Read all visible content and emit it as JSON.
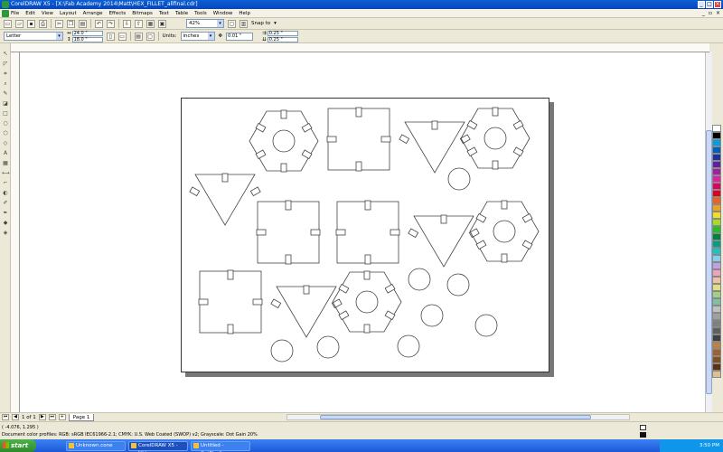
{
  "window": {
    "title": "CorelDRAW X5 - [X:\\Fab Academy 2014\\Matt\\HEX_FILLET_allfinal.cdr]"
  },
  "menubar": {
    "items": [
      "File",
      "Edit",
      "View",
      "Layout",
      "Arrange",
      "Effects",
      "Bitmaps",
      "Text",
      "Table",
      "Tools",
      "Window",
      "Help"
    ]
  },
  "toolbar": {
    "zoom": "42%",
    "snap": "Snap to"
  },
  "propertybar": {
    "paper": "Letter",
    "width": "24.0 \"",
    "height": "18.0 \"",
    "units_label": "Units:",
    "units": "inches",
    "nudge": "0.01 \"",
    "dup_x": "0.25 \"",
    "dup_y": "0.25 \""
  },
  "pagenav": {
    "counter": "1 of 1",
    "tab": "Page 1"
  },
  "status": {
    "coords": "( -4.076, 1.295 )",
    "profile": "Document color profiles: RGB: sRGB IEC61966-2.1; CMYK: U.S. Web Coated (SWOP) v2; Grayscale: Dot Gain 20%"
  },
  "taskbar": {
    "start": "start",
    "tasks": [
      "Unknown.cone",
      "CorelDRAW X5 - [X:\\...",
      "Untitled - CutStudio"
    ],
    "clock": "3:50 PM"
  },
  "palette": [
    "#ffffff",
    "#000000",
    "#00a0e0",
    "#0060c0",
    "#2030a0",
    "#6020a0",
    "#a020a0",
    "#e020a0",
    "#e00060",
    "#e00020",
    "#f06020",
    "#f0a020",
    "#f0e020",
    "#a0e020",
    "#20c020",
    "#008040",
    "#00a080",
    "#20c0c0",
    "#80d0f0",
    "#c0a0e0",
    "#f0a0c0",
    "#f0c0a0",
    "#e0e080",
    "#a0d080",
    "#80c0a0",
    "#c0c0c0",
    "#a0a0a0",
    "#808080",
    "#606060",
    "#404040",
    "#c08040",
    "#a06030",
    "#805020",
    "#603010",
    "#e0c090"
  ],
  "icons": {
    "tools": [
      "pick-tool-icon",
      "shape-tool-icon",
      "crop-tool-icon",
      "zoom-tool-icon",
      "freehand-tool-icon",
      "smart-fill-icon",
      "rectangle-tool-icon",
      "ellipse-tool-icon",
      "polygon-tool-icon",
      "basic-shapes-icon",
      "text-tool-icon",
      "table-tool-icon",
      "dimension-tool-icon",
      "connector-tool-icon",
      "blend-tool-icon",
      "eyedropper-tool-icon",
      "outline-tool-icon",
      "fill-tool-icon",
      "interactive-fill-icon"
    ]
  }
}
